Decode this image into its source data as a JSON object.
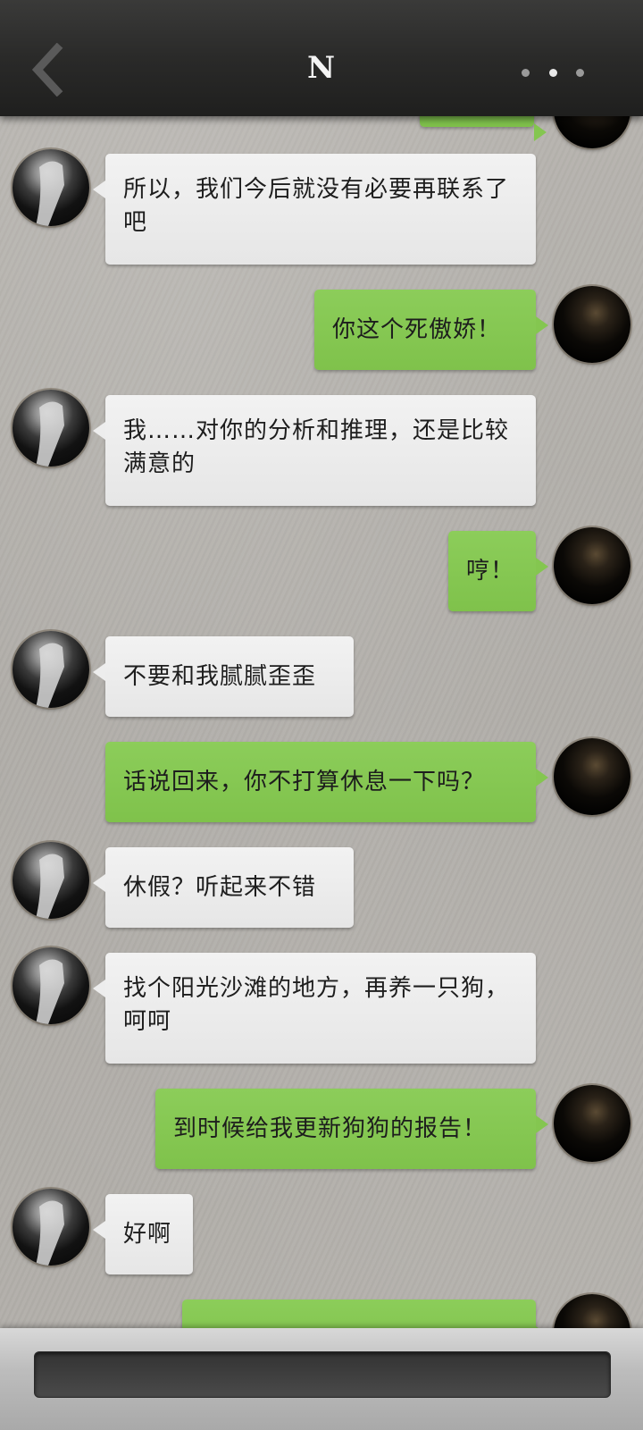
{
  "header": {
    "title": "N",
    "back_icon": "chevron-left-icon",
    "more_icon": "more-dots-icon"
  },
  "messages": [
    {
      "sender": "npc",
      "text": "所以，我们今后就没有必要再联系了吧"
    },
    {
      "sender": "me",
      "text": "你这个死傲娇！"
    },
    {
      "sender": "npc",
      "text": "我……对你的分析和推理，还是比较满意的"
    },
    {
      "sender": "me",
      "text": "哼！"
    },
    {
      "sender": "npc",
      "text": "不要和我腻腻歪歪"
    },
    {
      "sender": "me",
      "text": "话说回来，你不打算休息一下吗？"
    },
    {
      "sender": "npc",
      "text": "休假？听起来不错"
    },
    {
      "sender": "npc",
      "text": "找个阳光沙滩的地方，再养一只狗，呵呵"
    },
    {
      "sender": "me",
      "text": "到时候给我更新狗狗的报告！"
    },
    {
      "sender": "npc",
      "text": "好啊"
    }
  ],
  "input": {
    "placeholder": ""
  },
  "colors": {
    "outgoing_bubble": "#84c650",
    "incoming_bubble": "#ededed",
    "header_bg": "#2a2a29"
  }
}
